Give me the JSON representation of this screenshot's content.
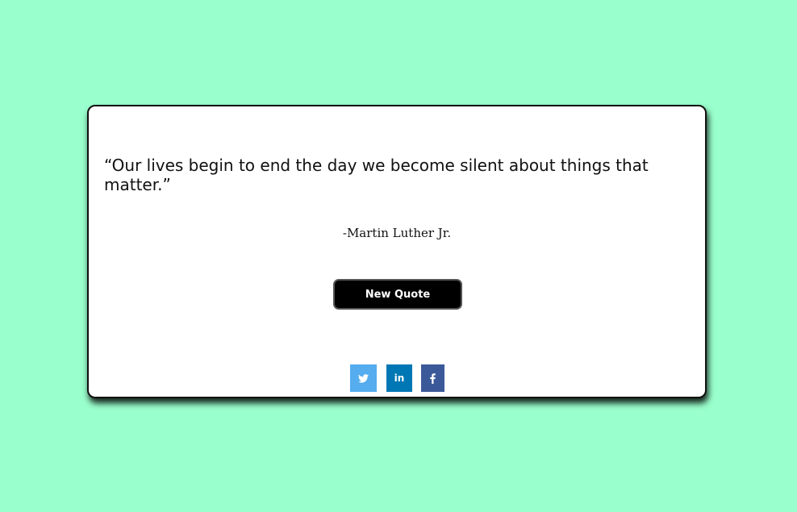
{
  "quote": {
    "text": "“Our lives begin to end the day we become silent about things that matter.”",
    "author": "-Martin Luther Jr."
  },
  "buttons": {
    "new_quote_label": "New Quote"
  },
  "share": {
    "twitter": {
      "icon": "twitter-icon",
      "color": "#55acee"
    },
    "linkedin": {
      "icon": "linkedin-icon",
      "label": "in",
      "color": "#0077b5"
    },
    "facebook": {
      "icon": "facebook-icon",
      "color": "#3b5998"
    }
  },
  "colors": {
    "background": "#99ffcc",
    "card": "#ffffff",
    "button": "#000000"
  }
}
